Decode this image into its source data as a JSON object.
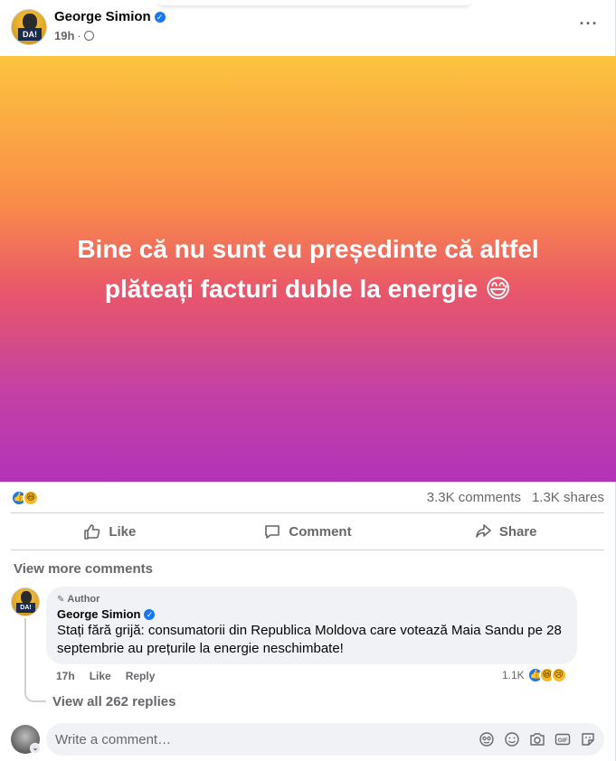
{
  "post": {
    "author": "George Simion",
    "time": "19h",
    "avatar_text": "DA!",
    "body_text": "Bine că nu sunt eu președinte că altfel plăteați facturi duble la energie 😅",
    "gradient_colors": [
      "#fcc43e",
      "#f98b4a",
      "#e9576a",
      "#c240a6",
      "#b332b8"
    ]
  },
  "stats": {
    "comments": "3.3K comments",
    "shares": "1.3K shares"
  },
  "actions": {
    "like": "Like",
    "comment": "Comment",
    "share": "Share"
  },
  "comments": {
    "view_more": "View more comments",
    "items": [
      {
        "badge": "Author",
        "name": "George Simion",
        "text": "Stați fără grijă: consumatorii din Republica Moldova care votează Maia Sandu pe 28 septembrie au prețurile la energie neschimbate!",
        "time": "17h",
        "like_label": "Like",
        "reply_label": "Reply",
        "reaction_count": "1.1K"
      }
    ],
    "view_replies": "View all 262 replies"
  },
  "composer": {
    "placeholder": "Write a comment…",
    "tools": [
      "avatar-sticker-icon",
      "emoji-icon",
      "camera-icon",
      "gif-icon",
      "sticker-icon"
    ]
  },
  "colors": {
    "accent": "#1877f2",
    "secondary_text": "#65676b",
    "bubble_bg": "#f0f2f5"
  }
}
